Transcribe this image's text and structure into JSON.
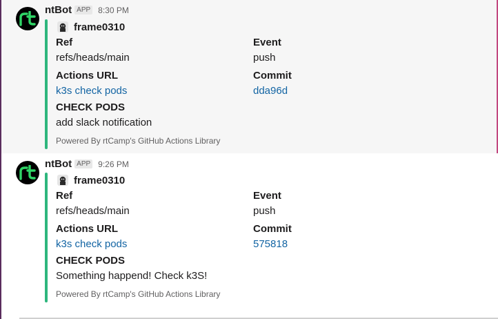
{
  "messages": [
    {
      "sender": "ntBot",
      "badge": "APP",
      "time": "8:30 PM",
      "author": "frame0310",
      "fields": {
        "ref_title": "Ref",
        "ref_value": "refs/heads/main",
        "event_title": "Event",
        "event_value": "push",
        "url_title": "Actions URL",
        "url_value": "k3s check pods",
        "commit_title": "Commit",
        "commit_value": "dda96d"
      },
      "section_title": "CHECK PODS",
      "section_text": "add slack notification",
      "footer": "Powered By rtCamp's GitHub Actions Library"
    },
    {
      "sender": "ntBot",
      "badge": "APP",
      "time": "9:26 PM",
      "author": "frame0310",
      "fields": {
        "ref_title": "Ref",
        "ref_value": "refs/heads/main",
        "event_title": "Event",
        "event_value": "push",
        "url_title": "Actions URL",
        "url_value": "k3s check pods",
        "commit_title": "Commit",
        "commit_value": "575818"
      },
      "section_title": "CHECK PODS",
      "section_text": "Something happend! Check k3S!",
      "footer": "Powered By rtCamp's GitHub Actions Library"
    }
  ],
  "colors": {
    "attachment_bar": "#2eb67d",
    "link": "#1264a3",
    "avatar_logo": "#2fd566"
  },
  "icons": {
    "bot_avatar": "rt-logo-icon",
    "author_avatar": "author-avatar-icon"
  }
}
